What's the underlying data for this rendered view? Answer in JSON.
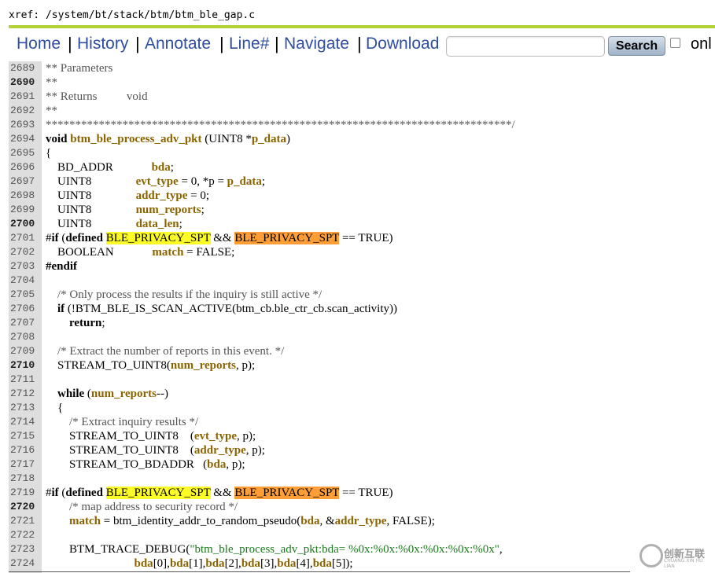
{
  "header": {
    "xref": "xref: /system/bt/stack/btm/btm_ble_gap.c"
  },
  "nav": {
    "links": [
      "Home",
      "History",
      "Annotate",
      "Line#",
      "Navigate",
      "Download"
    ],
    "search_label": "Search",
    "search_value": "",
    "only_label": "onl"
  },
  "colors": {
    "accent_rule": "#b2d235",
    "link": "#2e4ea2",
    "highlight_yellow": "#fcfc26",
    "highlight_orange": "#ff9e36"
  },
  "code_lines": [
    {
      "n": "2689",
      "t": "** Parameters"
    },
    {
      "n": "2690",
      "t": "**"
    },
    {
      "n": "2691",
      "t": "** Returns          void"
    },
    {
      "n": "2692",
      "t": "**"
    },
    {
      "n": "2693",
      "t": "*******************************************************************************/"
    },
    {
      "n": "2694",
      "t": "void btm_ble_process_adv_pkt (UINT8 *p_data)"
    },
    {
      "n": "2695",
      "t": "{"
    },
    {
      "n": "2696",
      "t": "    BD_ADDR             bda;"
    },
    {
      "n": "2697",
      "t": "    UINT8               evt_type = 0, *p = p_data;"
    },
    {
      "n": "2698",
      "t": "    UINT8               addr_type = 0;"
    },
    {
      "n": "2699",
      "t": "    UINT8               num_reports;"
    },
    {
      "n": "2700",
      "t": "    UINT8               data_len;"
    },
    {
      "n": "2701",
      "t": "#if (defined BLE_PRIVACY_SPT && BLE_PRIVACY_SPT == TRUE)"
    },
    {
      "n": "2702",
      "t": "    BOOLEAN             match = FALSE;"
    },
    {
      "n": "2703",
      "t": "#endif"
    },
    {
      "n": "2704",
      "t": ""
    },
    {
      "n": "2705",
      "t": "    /* Only process the results if the inquiry is still active */"
    },
    {
      "n": "2706",
      "t": "    if (!BTM_BLE_IS_SCAN_ACTIVE(btm_cb.ble_ctr_cb.scan_activity))"
    },
    {
      "n": "2707",
      "t": "        return;"
    },
    {
      "n": "2708",
      "t": ""
    },
    {
      "n": "2709",
      "t": "    /* Extract the number of reports in this event. */"
    },
    {
      "n": "2710",
      "t": "    STREAM_TO_UINT8(num_reports, p);"
    },
    {
      "n": "2711",
      "t": ""
    },
    {
      "n": "2712",
      "t": "    while (num_reports--)"
    },
    {
      "n": "2713",
      "t": "    {"
    },
    {
      "n": "2714",
      "t": "        /* Extract inquiry results */"
    },
    {
      "n": "2715",
      "t": "        STREAM_TO_UINT8    (evt_type, p);"
    },
    {
      "n": "2716",
      "t": "        STREAM_TO_UINT8    (addr_type, p);"
    },
    {
      "n": "2717",
      "t": "        STREAM_TO_BDADDR   (bda, p);"
    },
    {
      "n": "2718",
      "t": ""
    },
    {
      "n": "2719",
      "t": "#if (defined BLE_PRIVACY_SPT && BLE_PRIVACY_SPT == TRUE)"
    },
    {
      "n": "2720",
      "t": "        /* map address to security record */"
    },
    {
      "n": "2721",
      "t": "        match = btm_identity_addr_to_random_pseudo(bda, &addr_type, FALSE);"
    },
    {
      "n": "2722",
      "t": ""
    },
    {
      "n": "2723",
      "t": "        BTM_TRACE_DEBUG(\"btm_ble_process_adv_pkt:bda= %0x:%0x:%0x:%0x:%0x:%0x\","
    },
    {
      "n": "2724",
      "t": "                              bda[0],bda[1],bda[2],bda[3],bda[4],bda[5]);"
    }
  ],
  "bold_line_numbers": [
    "2690",
    "2700",
    "2710",
    "2720"
  ],
  "watermark": {
    "text": "创新互联",
    "sub": "CHUANG XIN HU LIAN"
  }
}
